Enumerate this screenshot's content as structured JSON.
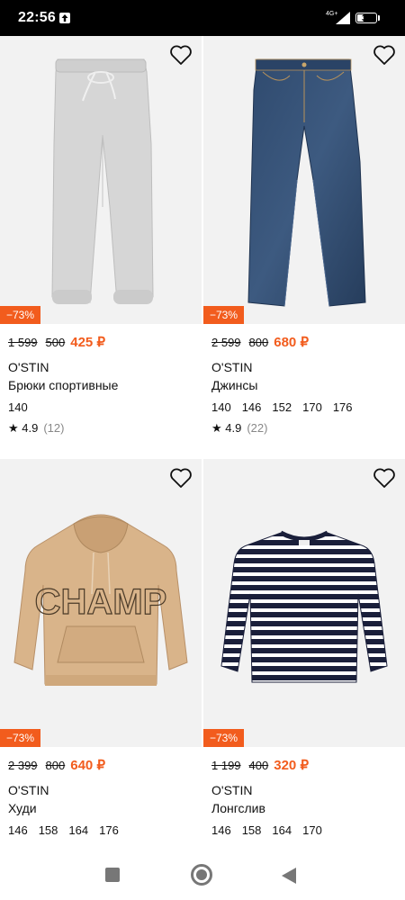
{
  "status": {
    "time": "22:56",
    "network": "4G+",
    "battery": "33",
    "battery_level": 0.33
  },
  "products": [
    {
      "discount": "−73%",
      "old_price": "1 599",
      "mid_price": "500",
      "price": "425 ₽",
      "brand": "O'STIN",
      "name": "Брюки спортивные",
      "sizes": [
        "140"
      ],
      "rating": "★ 4.9",
      "reviews": "(12)"
    },
    {
      "discount": "−73%",
      "old_price": "2 599",
      "mid_price": "800",
      "price": "680 ₽",
      "brand": "O'STIN",
      "name": "Джинсы",
      "sizes": [
        "140",
        "146",
        "152",
        "170",
        "176"
      ],
      "rating": "★ 4.9",
      "reviews": "(22)"
    },
    {
      "discount": "−73%",
      "old_price": "2 399",
      "mid_price": "800",
      "price": "640 ₽",
      "brand": "O'STIN",
      "name": "Худи",
      "sizes": [
        "146",
        "158",
        "164",
        "176"
      ]
    },
    {
      "discount": "−73%",
      "old_price": "1 199",
      "mid_price": "400",
      "price": "320 ₽",
      "brand": "O'STIN",
      "name": "Лонгслив",
      "sizes": [
        "146",
        "158",
        "164",
        "170"
      ]
    }
  ],
  "hoodie_print": "CHAMP",
  "icons": {
    "favorite": "heart-outline-icon",
    "upload": "upload-icon",
    "signal": "signal-icon",
    "battery": "battery-icon",
    "recents": "square-icon",
    "home": "circle-icon",
    "back": "triangle-back-icon"
  },
  "colors": {
    "accent": "#f25c1d",
    "background": "#ffffff",
    "photo_bg": "#f2f2f2"
  }
}
